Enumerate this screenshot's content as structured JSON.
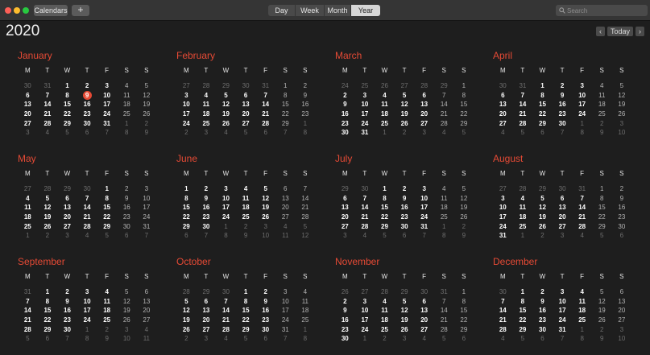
{
  "toolbar": {
    "calendars_label": "Calendars",
    "add_label": "+",
    "views": [
      {
        "label": "Day",
        "selected": false
      },
      {
        "label": "Week",
        "selected": false
      },
      {
        "label": "Month",
        "selected": false
      },
      {
        "label": "Year",
        "selected": true
      }
    ],
    "search_placeholder": "Search"
  },
  "header": {
    "year": "2020",
    "prev_label": "‹",
    "today_label": "Today",
    "next_label": "›"
  },
  "accent_color": "#e64a35",
  "weekday_headers": [
    "M",
    "T",
    "W",
    "T",
    "F",
    "S",
    "S"
  ],
  "today": {
    "month": 0,
    "day": 9
  },
  "months": [
    {
      "name": "January",
      "lead": [
        30,
        31
      ],
      "days": 31
    },
    {
      "name": "February",
      "lead": [
        27,
        28,
        29,
        30,
        31
      ],
      "days": 29
    },
    {
      "name": "March",
      "lead": [
        24,
        25,
        26,
        27,
        28,
        29
      ],
      "days": 31
    },
    {
      "name": "April",
      "lead": [
        30,
        31
      ],
      "days": 30
    },
    {
      "name": "May",
      "lead": [
        27,
        28,
        29,
        30
      ],
      "days": 31
    },
    {
      "name": "June",
      "lead": [],
      "days": 30
    },
    {
      "name": "July",
      "lead": [
        29,
        30
      ],
      "days": 31
    },
    {
      "name": "August",
      "lead": [
        27,
        28,
        29,
        30,
        31
      ],
      "days": 31
    },
    {
      "name": "September",
      "lead": [
        31
      ],
      "days": 30
    },
    {
      "name": "October",
      "lead": [
        28,
        29,
        30
      ],
      "days": 31
    },
    {
      "name": "November",
      "lead": [
        26,
        27,
        28,
        29,
        30,
        31
      ],
      "days": 30
    },
    {
      "name": "December",
      "lead": [
        30
      ],
      "days": 31
    }
  ]
}
